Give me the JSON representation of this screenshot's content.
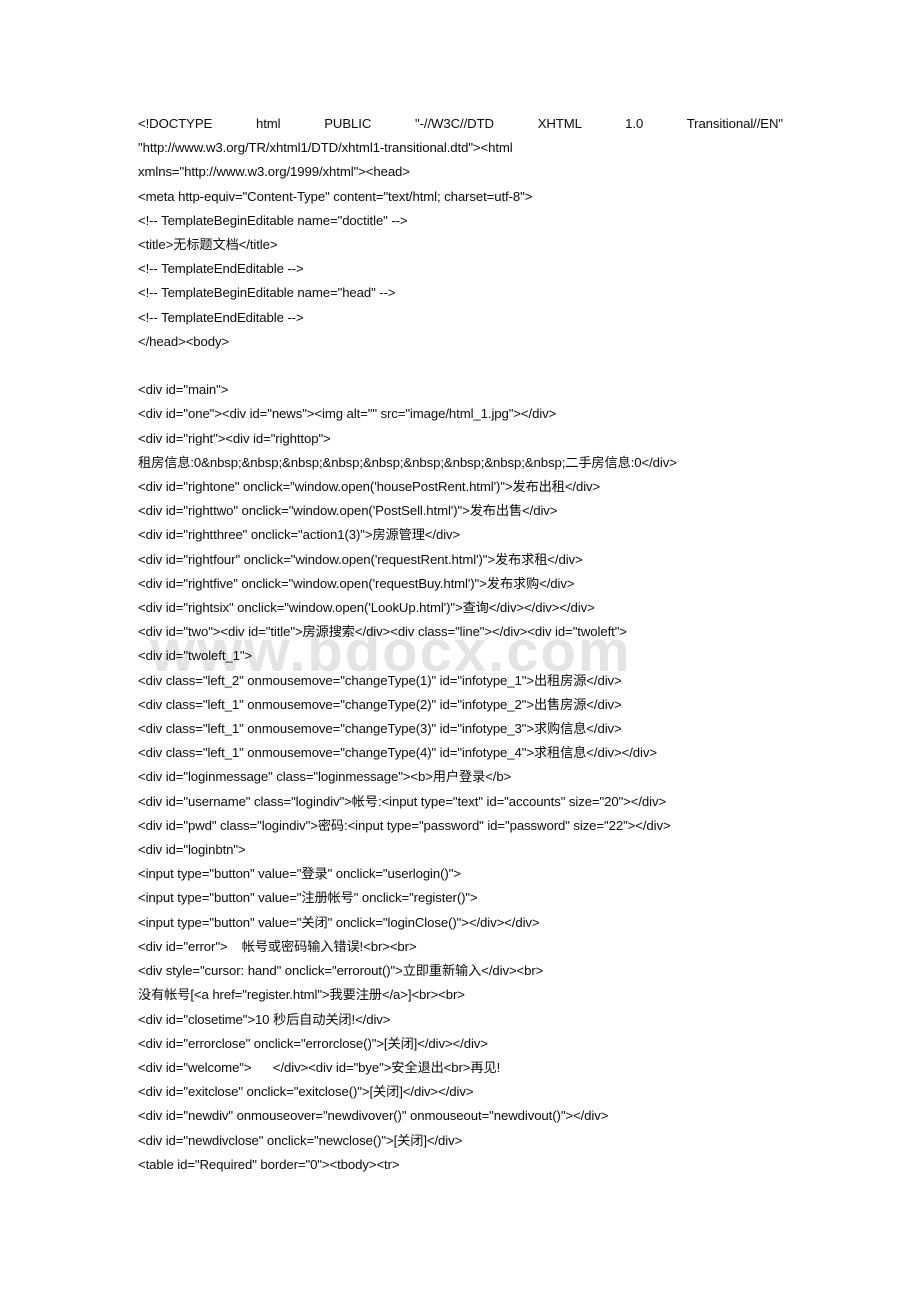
{
  "document": {
    "type": "source-code-listing",
    "watermark": "www.bdocx.com",
    "lines": [
      {
        "id": "line-1",
        "text": "<!DOCTYPE html PUBLIC \"-//W3C//DTD XHTML 1.0 Transitional//EN\"",
        "justified": true
      },
      {
        "id": "line-2",
        "text": "\"http://www.w3.org/TR/xhtml1/DTD/xhtml1-transitional.dtd\"><html"
      },
      {
        "id": "line-3",
        "text": "xmlns=\"http://www.w3.org/1999/xhtml\"><head>"
      },
      {
        "id": "line-4",
        "text": "<meta http-equiv=\"Content-Type\" content=\"text/html; charset=utf-8\">"
      },
      {
        "id": "line-5",
        "text": "<!-- TemplateBeginEditable name=\"doctitle\" -->"
      },
      {
        "id": "line-6",
        "text": "<title>无标题文档</title>"
      },
      {
        "id": "line-7",
        "text": "<!-- TemplateEndEditable -->"
      },
      {
        "id": "line-8",
        "text": "<!-- TemplateBeginEditable name=\"head\" -->"
      },
      {
        "id": "line-9",
        "text": "<!-- TemplateEndEditable -->"
      },
      {
        "id": "line-10",
        "text": "</head><body>"
      },
      {
        "id": "line-11",
        "text": "",
        "blank": true
      },
      {
        "id": "line-12",
        "text": "<div id=\"main\">"
      },
      {
        "id": "line-13",
        "text": "<div id=\"one\"><div id=\"news\"><img alt=\"\" src=\"image/html_1.jpg\"></div>"
      },
      {
        "id": "line-14",
        "text": "<div id=\"right\"><div id=\"righttop\">"
      },
      {
        "id": "line-15",
        "text": "租房信息:0&nbsp;&nbsp;&nbsp;&nbsp;&nbsp;&nbsp;&nbsp;&nbsp;&nbsp;二手房信息:0</div>"
      },
      {
        "id": "line-16",
        "text": "<div id=\"rightone\" onclick=\"window.open('housePostRent.html')\">发布出租</div>"
      },
      {
        "id": "line-17",
        "text": "<div id=\"righttwo\" onclick=\"window.open('PostSell.html')\">发布出售</div>"
      },
      {
        "id": "line-18",
        "text": "<div id=\"rightthree\" onclick=\"action1(3)\">房源管理</div>"
      },
      {
        "id": "line-19",
        "text": "<div id=\"rightfour\" onclick=\"window.open('requestRent.html')\">发布求租</div>"
      },
      {
        "id": "line-20",
        "text": "<div id=\"rightfive\" onclick=\"window.open('requestBuy.html')\">发布求购</div>"
      },
      {
        "id": "line-21",
        "text": "<div id=\"rightsix\" onclick=\"window.open('LookUp.html')\">查询</div></div></div>"
      },
      {
        "id": "line-22",
        "text": "<div id=\"two\"><div id=\"title\">房源搜索</div><div class=\"line\"></div><div id=\"twoleft\">"
      },
      {
        "id": "line-23",
        "text": "<div id=\"twoleft_1\">"
      },
      {
        "id": "line-24",
        "text": "<div class=\"left_2\" onmousemove=\"changeType(1)\" id=\"infotype_1\">出租房源</div>"
      },
      {
        "id": "line-25",
        "text": "<div class=\"left_1\" onmousemove=\"changeType(2)\" id=\"infotype_2\">出售房源</div>"
      },
      {
        "id": "line-26",
        "text": "<div class=\"left_1\" onmousemove=\"changeType(3)\" id=\"infotype_3\">求购信息</div>"
      },
      {
        "id": "line-27",
        "text": "<div class=\"left_1\" onmousemove=\"changeType(4)\" id=\"infotype_4\">求租信息</div></div>"
      },
      {
        "id": "line-28",
        "text": "<div id=\"loginmessage\" class=\"loginmessage\"><b>用户登录</b>"
      },
      {
        "id": "line-29",
        "text": "<div id=\"username\" class=\"logindiv\">帐号:<input type=\"text\" id=\"accounts\" size=\"20\"></div>"
      },
      {
        "id": "line-30",
        "text": "<div id=\"pwd\" class=\"logindiv\">密码:<input type=\"password\" id=\"password\" size=\"22\"></div>"
      },
      {
        "id": "line-31",
        "text": "<div id=\"loginbtn\">"
      },
      {
        "id": "line-32",
        "text": "<input type=\"button\" value=\"登录\" onclick=\"userlogin()\">"
      },
      {
        "id": "line-33",
        "text": "<input type=\"button\" value=\"注册帐号\" onclick=\"register()\">"
      },
      {
        "id": "line-34",
        "text": "<input type=\"button\" value=\"关闭\" onclick=\"loginClose()\"></div></div>"
      },
      {
        "id": "line-35",
        "text": "<div id=\"error\">    帐号或密码输入错误!<br><br>"
      },
      {
        "id": "line-36",
        "text": "<div style=\"cursor: hand\" onclick=\"errorout()\">立即重新输入</div><br>"
      },
      {
        "id": "line-37",
        "text": "没有帐号[<a href=\"register.html\">我要注册</a>]<br><br>"
      },
      {
        "id": "line-38",
        "text": "<div id=\"closetime\">10 秒后自动关闭!</div>"
      },
      {
        "id": "line-39",
        "text": "<div id=\"errorclose\" onclick=\"errorclose()\">[关闭]</div></div>"
      },
      {
        "id": "line-40",
        "text": "<div id=\"welcome\">      </div><div id=\"bye\">安全退出<br>再见!"
      },
      {
        "id": "line-41",
        "text": "<div id=\"exitclose\" onclick=\"exitclose()\">[关闭]</div></div>"
      },
      {
        "id": "line-42",
        "text": "<div id=\"newdiv\" onmouseover=\"newdivover()\" onmouseout=\"newdivout()\"></div>"
      },
      {
        "id": "line-43",
        "text": "<div id=\"newdivclose\" onclick=\"newclose()\">[关闭]</div>"
      },
      {
        "id": "line-44",
        "text": "<table id=\"Required\" border=\"0\"><tbody><tr>"
      }
    ]
  },
  "colors": {
    "page_background": "#ffffff",
    "text": "#0d0d0d",
    "watermark": "#e4e4e4"
  }
}
